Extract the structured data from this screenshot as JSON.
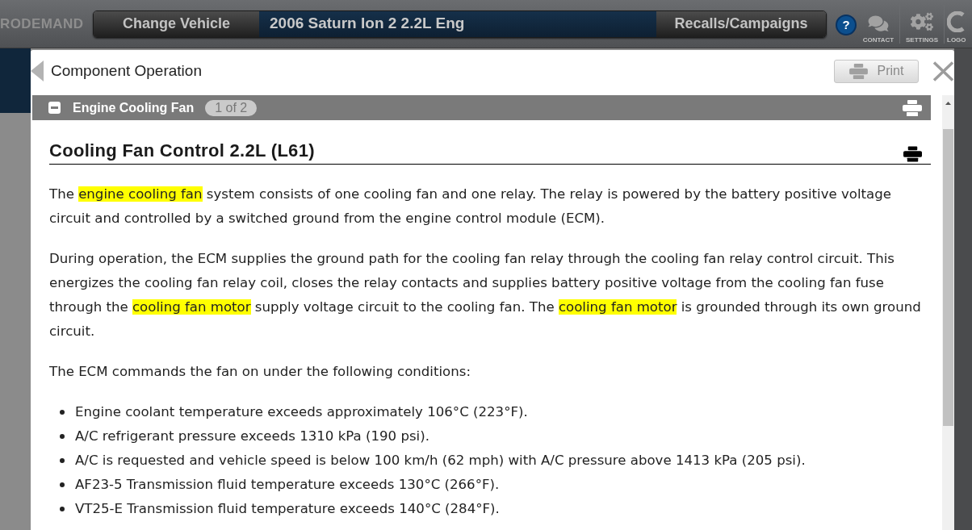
{
  "top_bar": {
    "logo": "RODEMAND",
    "change_vehicle_button": "Change Vehicle",
    "vehicle": "2006 Saturn Ion 2 2.2L Eng",
    "recalls_button": "Recalls/Campaigns",
    "help_button": "?",
    "tools": [
      {
        "kind": "contact",
        "label": "CONTACT"
      },
      {
        "kind": "settings",
        "label": "SETTINGS"
      },
      {
        "kind": "logout",
        "label": "LOGO"
      }
    ]
  },
  "dialog": {
    "title": "Component Operation",
    "print_button": "Print",
    "section": {
      "title": "Engine Cooling Fan",
      "expanded": true,
      "page": "1 of 2"
    },
    "heading": "Cooling Fan Control 2.2L (L61)",
    "paragraphs": [
      {
        "segments": [
          {
            "text": "The ",
            "highlighted": false
          },
          {
            "text": "engine cooling fan",
            "highlighted": true
          },
          {
            "text": " system consists of one cooling fan and one relay. The relay is powered by the battery positive voltage circuit and controlled by a switched ground from the engine control module (ECM).",
            "highlighted": false
          }
        ]
      },
      {
        "segments": [
          {
            "text": "During operation, the ECM supplies the ground path for the cooling fan relay through the cooling fan relay control circuit. This energizes the cooling fan relay coil, closes the relay contacts and supplies battery positive voltage from the cooling fan fuse through the ",
            "highlighted": false
          },
          {
            "text": "cooling fan motor",
            "highlighted": true
          },
          {
            "text": " supply voltage circuit to the cooling fan. The ",
            "highlighted": false
          },
          {
            "text": "cooling fan motor",
            "highlighted": true
          },
          {
            "text": " is grounded through its own ground circuit.",
            "highlighted": false
          }
        ]
      },
      {
        "segments": [
          {
            "text": "The ECM commands the fan on under the following conditions:",
            "highlighted": false
          }
        ]
      }
    ],
    "bullets": [
      "Engine coolant temperature exceeds approximately 106°C (223°F).",
      "A/C refrigerant pressure exceeds 1310 kPa (190 psi).",
      "A/C is requested and vehicle speed is below 100 km/h (62 mph) with A/C pressure above 1413 kPa (205 psi).",
      "AF23-5 Transmission fluid temperature exceeds 130°C (266°F).",
      "VT25-E Transmission fluid temperature exceeds 140°C (284°F)."
    ]
  }
}
